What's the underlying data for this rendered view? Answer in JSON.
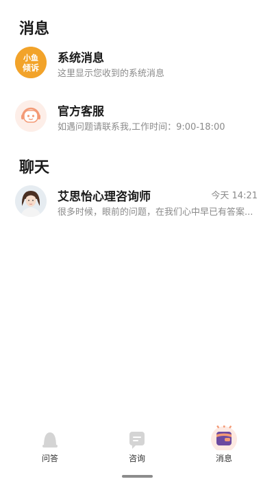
{
  "sections": {
    "messages_title": "消息",
    "chat_title": "聊天"
  },
  "system_message": {
    "avatar_icon": "xiaoyu-qingsu-logo-icon",
    "logo_text_top": "小鱼",
    "logo_text_bottom": "倾诉",
    "title": "系统消息",
    "subtitle": "这里显示您收到的系统消息"
  },
  "customer_service": {
    "avatar_icon": "headset-robot-icon",
    "title": "官方客服",
    "subtitle": "如遇问题请联系我,工作时间：9:00-18:00"
  },
  "chats": [
    {
      "avatar_icon": "counselor-avatar",
      "name": "艾思怡心理咨询师",
      "time": "今天 14:21",
      "preview": "很多时候，眼前的问题，在我们心中早已有答案..."
    }
  ],
  "tabbar": {
    "tabs": [
      {
        "label": "问答",
        "icon": "qa-bell-icon",
        "active": false
      },
      {
        "label": "咨询",
        "icon": "consult-chat-icon",
        "active": false
      },
      {
        "label": "消息",
        "icon": "message-envelope-icon",
        "active": true
      }
    ]
  },
  "colors": {
    "logo_orange": "#f2a32a",
    "service_peach": "#fdeee8",
    "active_purple": "#6b4aa0",
    "active_orange": "#f39a76",
    "inactive_gray": "#d4d4d4"
  }
}
